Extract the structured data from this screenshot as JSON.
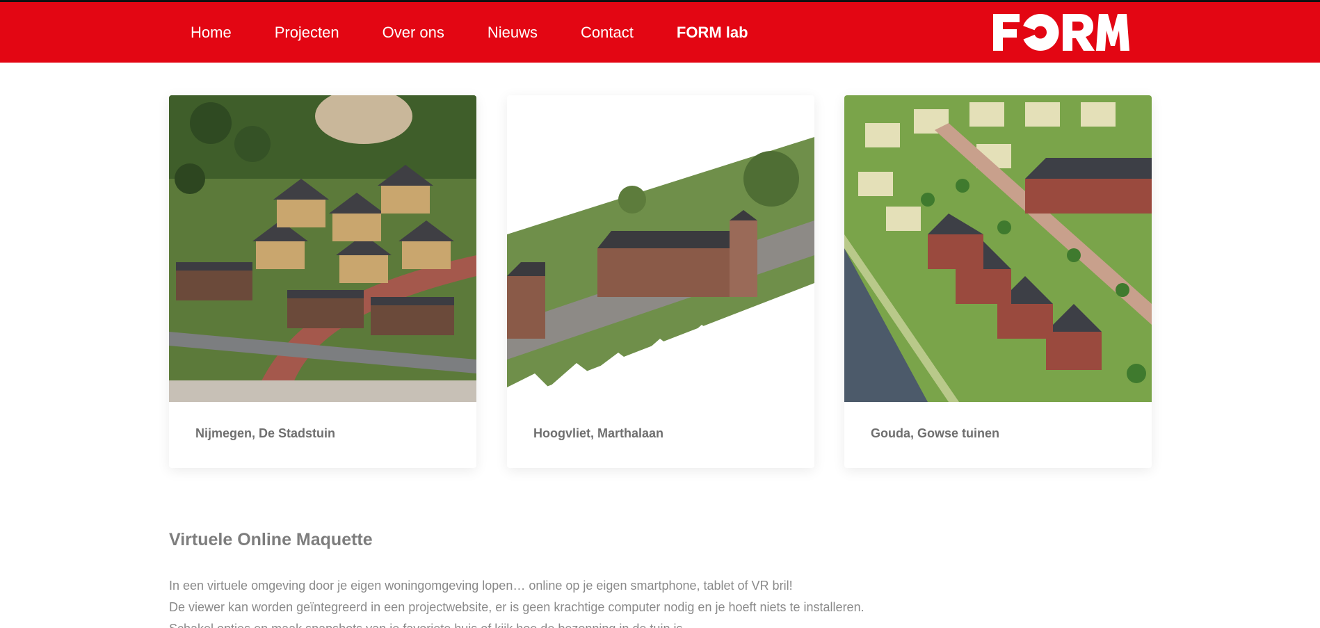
{
  "colors": {
    "brand_red": "#e30613",
    "text_grey": "#7a7a7a",
    "background": "#ffffff"
  },
  "nav": {
    "items": [
      {
        "label": "Home"
      },
      {
        "label": "Projecten"
      },
      {
        "label": "Over ons"
      },
      {
        "label": "Nieuws"
      },
      {
        "label": "Contact"
      },
      {
        "label": "FORM lab"
      }
    ]
  },
  "logo": {
    "text": "FORM"
  },
  "projects": [
    {
      "title": "Nijmegen, De Stadstuin",
      "image": "aerial render of housing development with curved street"
    },
    {
      "title": "Hoogvliet, Marthalaan",
      "image": "aerial render of row houses along a street with faded edges"
    },
    {
      "title": "Gouda, Gowse tuinen",
      "image": "aerial render of housing along a canal"
    }
  ],
  "section": {
    "title": "Virtuele Online Maquette",
    "paragraphs": [
      "In een virtuele omgeving door je eigen woningomgeving lopen… online op je eigen smartphone, tablet of VR bril!",
      "De viewer kan worden geïntegreerd in een projectwebsite, er is geen krachtige computer nodig en je hoeft niets te installeren.",
      "Schakel opties en maak snapshots van je favoriete huis of kijk hoe de bezonning in de tuin is."
    ]
  }
}
